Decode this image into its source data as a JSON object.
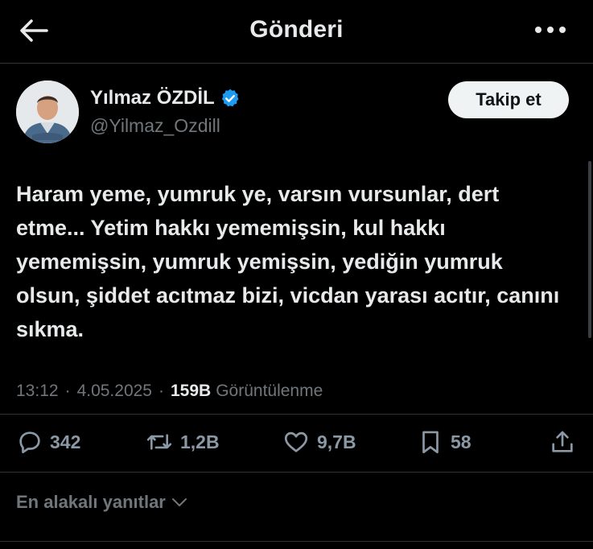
{
  "header": {
    "title": "Gönderi",
    "back_icon": "arrow-left-icon",
    "more_icon": "more-horizontal-icon"
  },
  "author": {
    "name": "Yılmaz ÖZDİL",
    "handle": "@Yilmaz_Ozdill",
    "verified_icon": "verified-badge-icon",
    "verified_color": "#1d9bf0"
  },
  "follow_button": {
    "label": "Takip et"
  },
  "post": {
    "text": "Haram yeme, yumruk ye, varsın vursunlar, dert etme... Yetim hakkı yememişsin, kul hakkı yememişsin, yumruk yemişsin, yediğin yumruk olsun, şiddet acıtmaz bizi, vicdan yarası acıtır, canını sıkma."
  },
  "meta": {
    "time": "13:12",
    "date": "4.05.2025",
    "views_count": "159B",
    "views_label": "Görüntülenme",
    "separator": "·"
  },
  "actions": {
    "replies": {
      "icon": "reply-icon",
      "count": "342"
    },
    "reposts": {
      "icon": "repost-icon",
      "count": "1,2B"
    },
    "likes": {
      "icon": "heart-icon",
      "count": "9,7B"
    },
    "bookmarks": {
      "icon": "bookmark-icon",
      "count": "58"
    },
    "share": {
      "icon": "share-icon"
    }
  },
  "replies_sort": {
    "label": "En alakalı yanıtlar",
    "icon": "chevron-down-icon"
  },
  "colors": {
    "background": "#000000",
    "text": "#e7e9ea",
    "muted": "#71767b",
    "divider": "#2f3336",
    "accent": "#1d9bf0"
  }
}
